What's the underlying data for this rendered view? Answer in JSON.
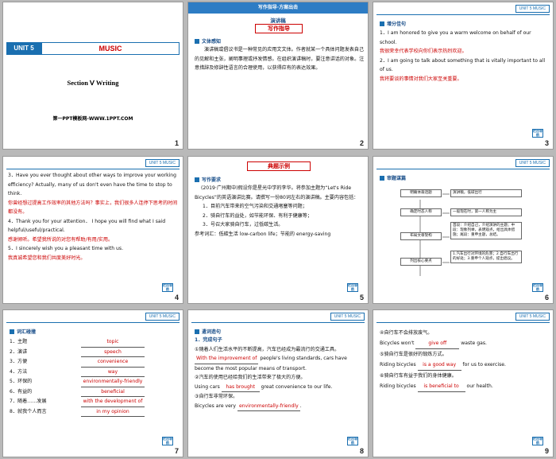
{
  "slides": {
    "s1": {
      "unit": "UNIT 5",
      "title": "MUSIC",
      "section": "Section Ⅴ  Writing",
      "watermark": "第一PPT模板网-WWW.1PPT.COM",
      "num": "1"
    },
    "s2": {
      "banner": "写作指导·方案出击",
      "sub": "演讲稿",
      "title2": "写作指导",
      "head": "文体感知",
      "body": "演讲稿或倡议书是一种常见的应用文文体。作者就某一个具体问题发表自己的见解和主张，阐明事理或抒发情感。在组织演讲稿时，要注意讲话的对象。注意措辞及修辞性语言的合理使用，以获得应有的表达效果。",
      "num": "2"
    },
    "s3": {
      "unit": "UNIT 5  MUSIC",
      "head": "增分佳句",
      "l1": "1．I am honored to give you a warm welcome on behalf of our school.",
      "l1c": "我很荣幸代表学校向你们表示热烈欢迎。",
      "l2": "2．I am going to talk about something that is vitally important to all of us.",
      "l2c": "我将要谈的事情对我们大家至关重要。",
      "back": "栏目导航",
      "num": "3"
    },
    "s4": {
      "unit": "UNIT 5  MUSIC",
      "l3": "3．Have you ever thought about other ways to improve your working efficiency? Actually, many of us don't even have the time to stop to think.",
      "l3c": "你曾经想过提高工作效率的其他方法吗？事实上，我们很多人连停下思考的时间都没有。",
      "l4": "4．Thank you for your attention． I hope you will find what I said helpful/useful/practical.",
      "l4c": "感谢倾听。希望我所说的对您有帮助/有用/实用。",
      "l5": "5．I sincerely wish you a pleasant time with us.",
      "l5c": "我真诚希望您和我们共度美好时光。",
      "back": "栏目导航",
      "num": "4"
    },
    "s5": {
      "title": "典题示例",
      "head": "写作要求",
      "body": "(2019·广州期中)假设你是星光中学的李华。将参加主题为“Let's Ride Bicycles”的英语演讲比赛。请撰写一份80词左右的演讲稿。主要内容包括：",
      "p1": "1．目前汽车带来的空气污染和交通堵塞等问题；",
      "p2": "2．骑自行车的益处，如节能环保、有利于健康等；",
      "p3": "3．号召大家骑自行车，过低碳生活。",
      "ref": "参考词汇：低碳生活 low-carbon life；节能的 energy-saving",
      "back": "栏目导航",
      "num": "5"
    },
    "s6": {
      "unit": "UNIT 5  MUSIC",
      "head": "审题谋篇",
      "b1": "明确体裁话题",
      "b2": "确定时态人称",
      "b3": "布局文章架构",
      "b4": "列出核心要点",
      "r1": "演讲稿，低碳出行",
      "r2": "一般现在时，第一人称为主",
      "r3": "首段：介绍自己，介绍演讲的主题；中段：现象列举，表明观点，给出具体措施；尾段：重申主题，总结。",
      "r4": "1.汽车出行对环境的危害；2.自行车出行的好处；3.重申个人观点，提出倡议。",
      "back": "栏目导航",
      "num": "6"
    },
    "s7": {
      "unit": "UNIT 5  MUSIC",
      "head": "词汇碰撞",
      "items": [
        {
          "cn": "1．主题",
          "en": "topic"
        },
        {
          "cn": "2．演讲",
          "en": "speech"
        },
        {
          "cn": "3．方便",
          "en": "convenience"
        },
        {
          "cn": "4．方法",
          "en": "way"
        },
        {
          "cn": "5．环保的",
          "en": "environmentally-friendly"
        },
        {
          "cn": "6．有益的",
          "en": "beneficial"
        },
        {
          "cn": "7．随着……发展",
          "en": "with the development of"
        },
        {
          "cn": "8．就我个人而言",
          "en": "in my opinion"
        }
      ],
      "back": "栏目导航",
      "num": "7"
    },
    "s8": {
      "unit": "UNIT 5  MUSIC",
      "head": "遣词造句",
      "sub": "1．完成句子",
      "c1": "①随着人们生活水平的不断提高，汽车已经成为最流行的交通工具。",
      "a1": "With the improvement of",
      "e1": "people's living standards, cars have become the most popular means of transport.",
      "c2": "②汽车的使用已经给我们的生活带来了极大的方便。",
      "e2a": "Using cars",
      "a2": "has brought",
      "e2b": "great convenience to our life.",
      "c3": "③自行车非常环保。",
      "e3a": "Bicycles are very",
      "a3": "environmentally-friendly",
      "back": "栏目导航",
      "num": "8"
    },
    "s9": {
      "unit": "UNIT 5  MUSIC",
      "c4": "④自行车不会排放废气。",
      "e4a": "Bicycles won't",
      "a4": "give off",
      "e4b": "waste gas.",
      "c5": "⑤骑自行车是很好的锻炼方式。",
      "e5a": "Riding bicycles",
      "a5": "is a good way",
      "e5b": "for us to exercise.",
      "c6": "⑥骑自行车有益于我们的身体健康。",
      "e6a": "Riding bicycles",
      "a6": "is beneficial to",
      "e6b": "our health.",
      "back": "栏目导航",
      "num": "9"
    }
  }
}
